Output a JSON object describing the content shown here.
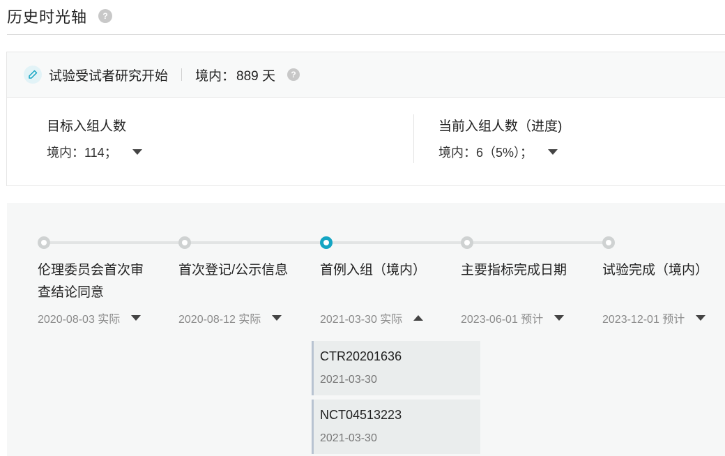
{
  "page": {
    "title": "历史时光轴",
    "help": "?"
  },
  "study": {
    "title": "试验受试者研究开始",
    "domestic_label": "境内：",
    "domestic_value": "889 天",
    "help": "?"
  },
  "enrollment": {
    "target": {
      "title": "目标入组人数",
      "value": "境内：114；"
    },
    "current": {
      "title": "当前入组人数（进度)",
      "value": "境内：6（5%）；"
    }
  },
  "timeline": {
    "milestones": [
      {
        "label": "伦理委员会首次审查结论同意",
        "date": "2020-08-03 实际",
        "state": "done",
        "expanded": false
      },
      {
        "label": "首次登记/公示信息",
        "date": "2020-08-12 实际",
        "state": "done",
        "expanded": false
      },
      {
        "label": "首例入组（境内）",
        "date": "2021-03-30 实际",
        "state": "active",
        "expanded": true
      },
      {
        "label": "主要指标完成日期",
        "date": "2023-06-01 预计",
        "state": "planned",
        "expanded": false
      },
      {
        "label": "试验完成（境内）",
        "date": "2023-12-01 预计",
        "state": "planned",
        "expanded": false
      }
    ],
    "registrations": [
      {
        "id": "CTR20201636",
        "date": "2021-03-30"
      },
      {
        "id": "NCT04513223",
        "date": "2021-03-30"
      }
    ]
  },
  "colors": {
    "accent": "#14a5c3",
    "dot_inactive": "#cfd2d2",
    "panel_bg": "#f6f7f7"
  },
  "icons": {
    "help": "question-circle-icon",
    "study": "pen-icon",
    "collapse": "caret-down-icon",
    "expand": "caret-up-icon"
  }
}
